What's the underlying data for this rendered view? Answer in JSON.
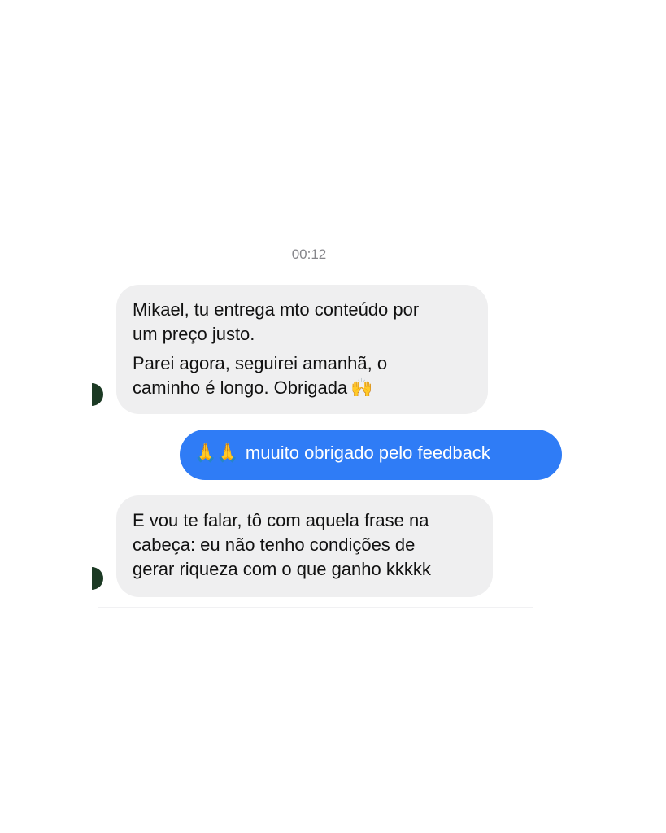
{
  "conversation": {
    "timestamp": "00:12",
    "messages": [
      {
        "direction": "incoming",
        "lines": [
          "Mikael, tu entrega mto conteúdo por",
          "um preço justo.",
          "Parei agora, seguirei amanhã, o",
          "caminho é longo. Obrigada"
        ],
        "emoji": "🙌",
        "emoji_name": "raising-hands-icon"
      },
      {
        "direction": "outgoing",
        "emoji": "🙏🙏",
        "emoji_name": "folded-hands-icon",
        "text": "muuito obrigado pelo feedback"
      },
      {
        "direction": "incoming",
        "lines": [
          "E vou te falar, tô com aquela frase na",
          "cabeça: eu não tenho condições de",
          "gerar riqueza com o que ganho kkkkk"
        ]
      }
    ]
  },
  "colors": {
    "incoming_bubble": "#efeff0",
    "outgoing_bubble": "#2f7cf6",
    "timestamp_text": "#86868b"
  }
}
